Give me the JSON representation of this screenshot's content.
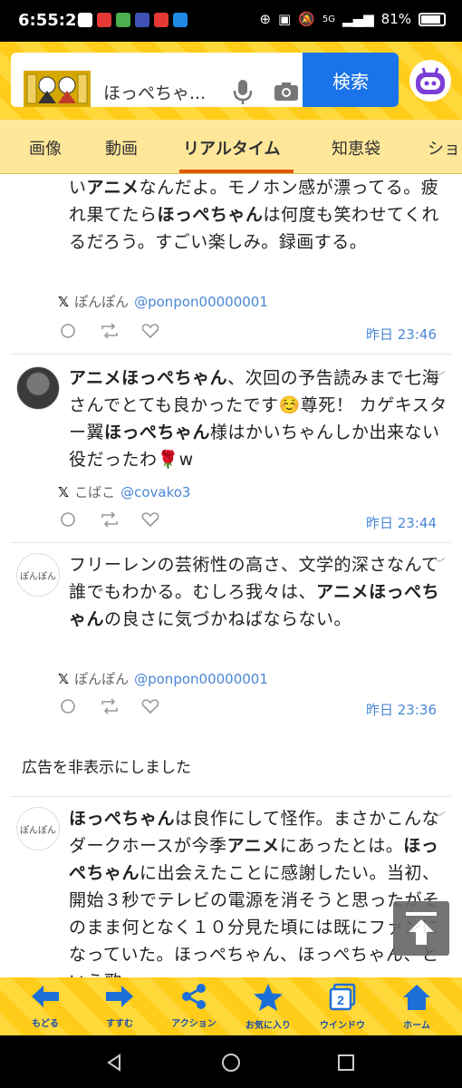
{
  "status_bar": {
    "time": "6:55:28",
    "signal": "5G",
    "battery": "81%"
  },
  "header": {
    "search_text": "ほっぺちゃ...",
    "search_button": "検索"
  },
  "tabs": [
    "画像",
    "動画",
    "リアルタイム",
    "知恵袋",
    "ショ"
  ],
  "posts": [
    {
      "html": "い<b>アニメ</b>なんだよ。モノホン感が漂ってる。疲れ果てたら<b>ほっぺちゃん</b>は何度も笑わせてくれるだろう。すごい楽しみ。録画する。",
      "author": "ぽんぽん",
      "handle": "@ponpon00000001",
      "time": "昨日 23:46"
    },
    {
      "html": "<b>アニメほっぺちゃん</b>、次回の予告読みまで七海さんでとても良かったです☺️尊死！ カゲキスター翼<b>ほっぺちゃん</b>様はかいちゃんしか出来ない役だったわ🌹w",
      "author": "こばこ",
      "handle": "@covako3",
      "time": "昨日 23:44"
    },
    {
      "html": "フリーレンの芸術性の高さ、文学的深さなんて誰でもわかる。むしろ我々は、<b>アニメほっぺちゃん</b>の良さに気づかねばならない。",
      "author": "ぽんぽん",
      "handle": "@ponpon00000001",
      "time": "昨日 23:36",
      "avatar_text": "ぽんぽん"
    },
    {
      "html": "<b>ほっぺちゃん</b>は良作にして怪作。まさかこんなダークホースが今季<b>アニメ</b>にあったとは。<b>ほっぺちゃん</b>に出会えたことに感謝したい。当初、開始３秒でテレビの電源を消そうと思ったがそのまま何となく１０分見た頃には既にファンになっていた。ほっぺちゃん、ほっぺちゃん、という歌",
      "avatar_text": "ぽんぽん"
    }
  ],
  "ad_notice": "広告を非表示にしました",
  "toolbar": [
    "もどる",
    "すすむ",
    "アクション",
    "お気に入り",
    "ウインドウ",
    "ホーム"
  ],
  "window_count": "2",
  "colors": {
    "accent": "#1a73e8",
    "tab_underline": "#e05a00",
    "link": "#4a86d6",
    "header_bg": "#ffd83a"
  }
}
